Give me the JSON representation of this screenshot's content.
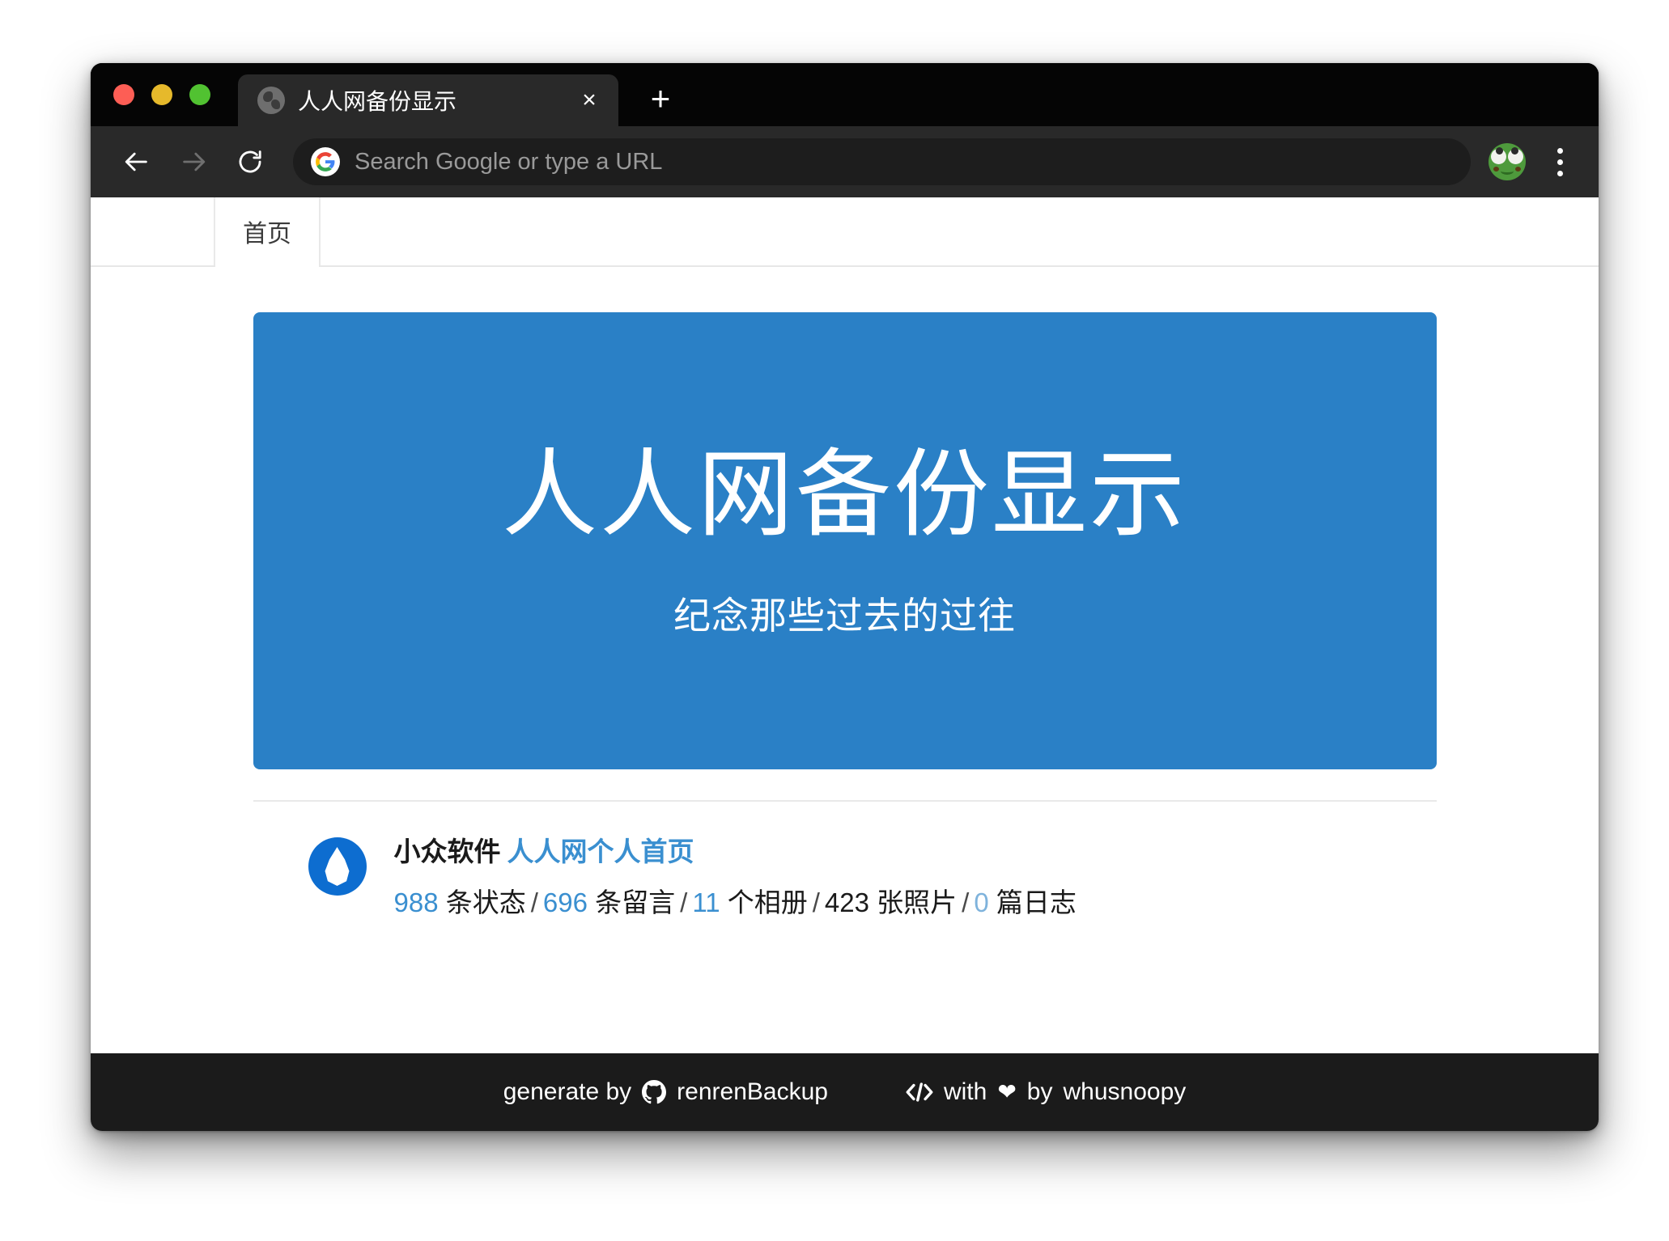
{
  "browser": {
    "window_controls": [
      "close",
      "minimize",
      "maximize"
    ],
    "tab": {
      "title": "人人网备份显示",
      "favicon": "globe-icon",
      "close_label": "×"
    },
    "new_tab_label": "+",
    "toolbar": {
      "back_icon": "arrow-left-icon",
      "forward_icon": "arrow-right-icon",
      "reload_icon": "reload-icon",
      "omnibox_placeholder": "Search Google or type a URL",
      "omnibox_value": "",
      "search_engine_icon": "google-g-icon",
      "profile_icon": "frog-avatar-icon",
      "menu_icon": "three-dots-icon"
    }
  },
  "page": {
    "navbar": {
      "items": [
        {
          "label": "首页",
          "active": true
        }
      ]
    },
    "jumbotron": {
      "title": "人人网备份显示",
      "subtitle": "纪念那些过去的过往",
      "background_color": "#2a80c6"
    },
    "profile": {
      "avatar_icon": "water-drop-avatar",
      "name": "小众软件",
      "home_link": "人人网个人首页",
      "stats": [
        {
          "value": "988",
          "unit": "条状态",
          "style": "link"
        },
        {
          "value": "696",
          "unit": "条留言",
          "style": "link"
        },
        {
          "value": "11",
          "unit": "个相册",
          "style": "link"
        },
        {
          "value": "423",
          "unit": "张照片",
          "style": "plain"
        },
        {
          "value": "0",
          "unit": "篇日志",
          "style": "muted"
        }
      ],
      "separator": "/"
    },
    "footer": {
      "generate_prefix": "generate by",
      "github_icon": "github-icon",
      "repo_name": "renrenBackup",
      "code_icon": "code-brackets-icon",
      "with_word": "with",
      "heart_icon": "heart-icon",
      "by_word": "by",
      "author": "whusnoopy"
    }
  },
  "colors": {
    "brand_blue": "#2a80c6",
    "link_blue": "#3a8fd0",
    "footer_bg": "#1b1b1b",
    "chrome_dark": "#292929"
  }
}
